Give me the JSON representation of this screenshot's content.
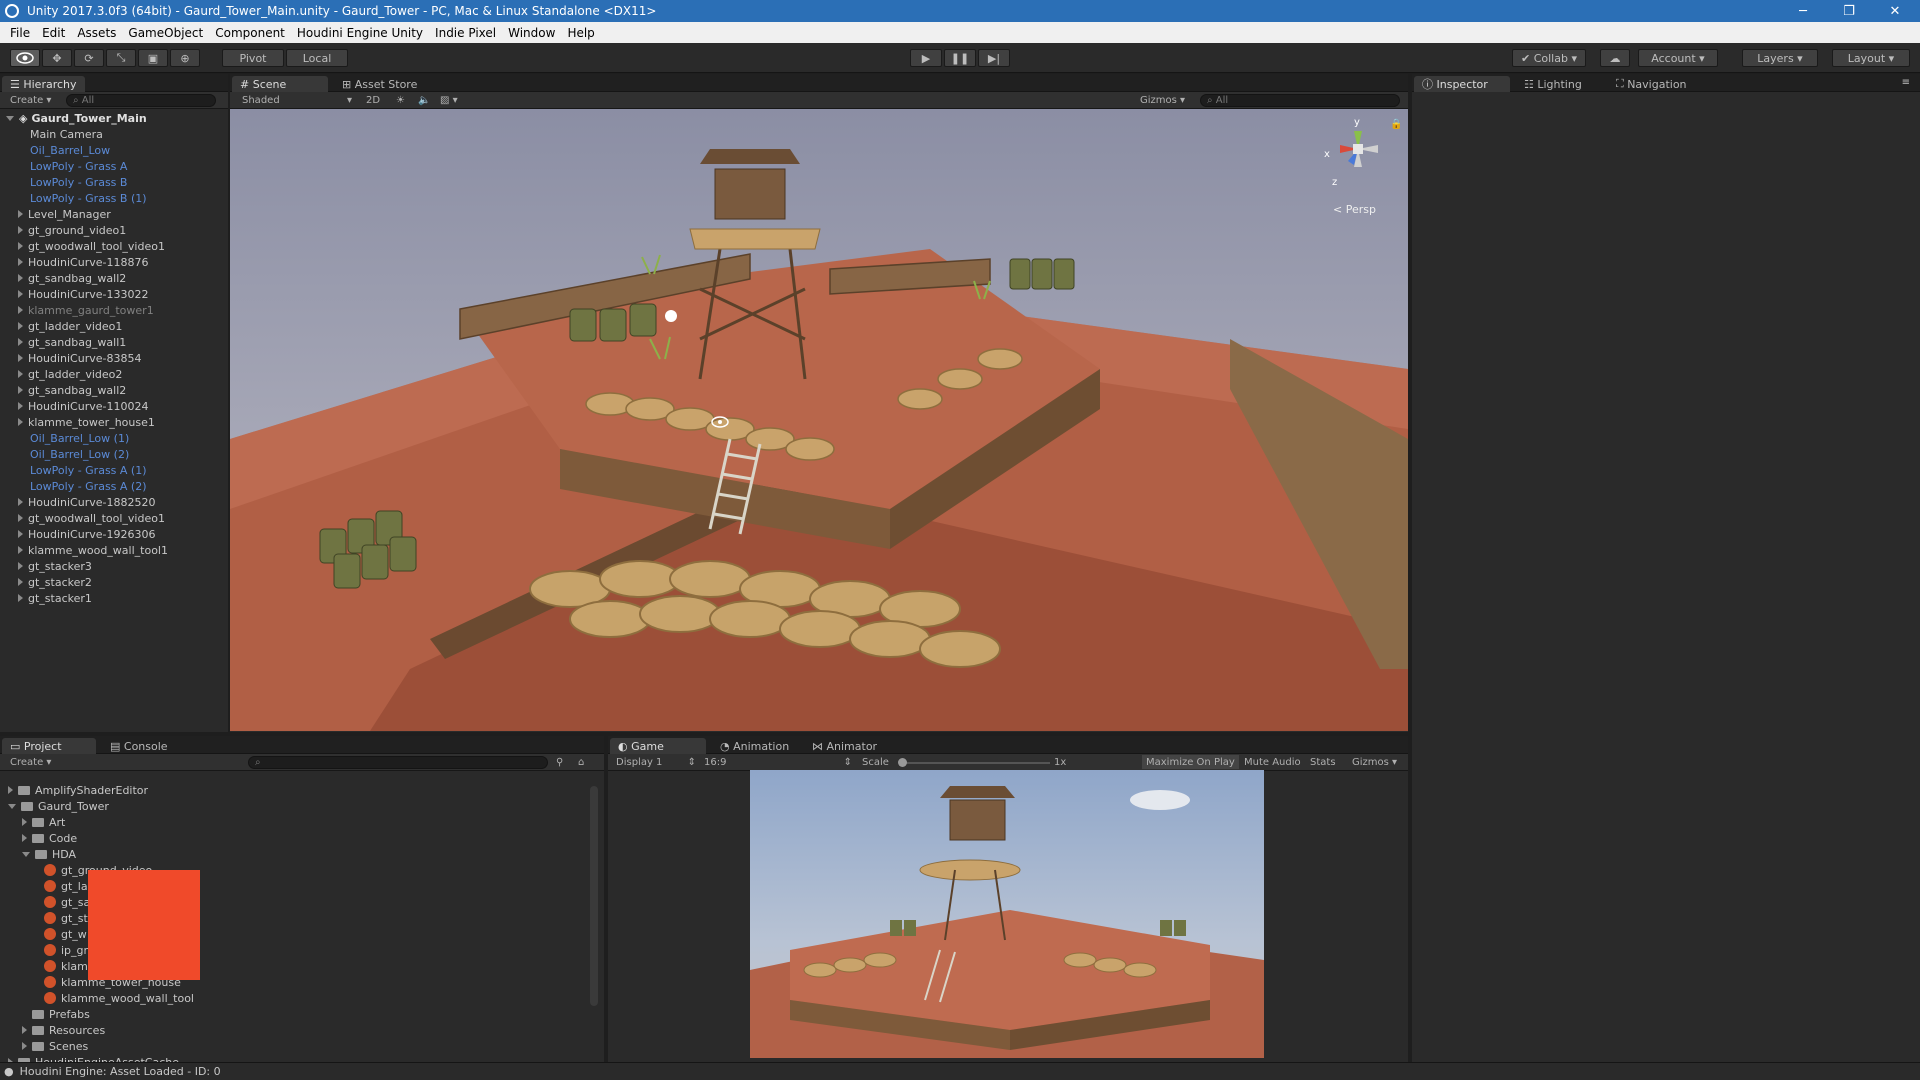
{
  "window": {
    "title": "Unity 2017.3.0f3 (64bit) - Gaurd_Tower_Main.unity - Gaurd_Tower - PC, Mac & Linux Standalone <DX11>",
    "controls": {
      "minimize": "─",
      "restore": "❐",
      "close": "✕"
    }
  },
  "menu": [
    "File",
    "Edit",
    "Assets",
    "GameObject",
    "Component",
    "Houdini Engine Unity",
    "Indie Pixel",
    "Window",
    "Help"
  ],
  "toolbar": {
    "pivot": "Pivot",
    "local": "Local",
    "collab": "Collab",
    "account": "Account",
    "layers": "Layers",
    "layout": "Layout"
  },
  "hierarchy": {
    "tab": "Hierarchy",
    "create": "Create",
    "search_placeholder": "All",
    "scene": "Gaurd_Tower_Main",
    "items": [
      {
        "label": "Main Camera",
        "kind": "normal",
        "expandable": false
      },
      {
        "label": "Oil_Barrel_Low",
        "kind": "prefab",
        "expandable": false
      },
      {
        "label": "LowPoly - Grass A",
        "kind": "prefab",
        "expandable": false
      },
      {
        "label": "LowPoly - Grass B",
        "kind": "prefab",
        "expandable": false
      },
      {
        "label": "LowPoly - Grass B (1)",
        "kind": "prefab",
        "expandable": false
      },
      {
        "label": "Level_Manager",
        "kind": "normal",
        "expandable": true
      },
      {
        "label": "gt_ground_video1",
        "kind": "normal",
        "expandable": true
      },
      {
        "label": "gt_woodwall_tool_video1",
        "kind": "normal",
        "expandable": true
      },
      {
        "label": "HoudiniCurve-118876",
        "kind": "normal",
        "expandable": true
      },
      {
        "label": "gt_sandbag_wall2",
        "kind": "normal",
        "expandable": true
      },
      {
        "label": "HoudiniCurve-133022",
        "kind": "normal",
        "expandable": true
      },
      {
        "label": "klamme_gaurd_tower1",
        "kind": "inactive",
        "expandable": true
      },
      {
        "label": "gt_ladder_video1",
        "kind": "normal",
        "expandable": true
      },
      {
        "label": "gt_sandbag_wall1",
        "kind": "normal",
        "expandable": true
      },
      {
        "label": "HoudiniCurve-83854",
        "kind": "normal",
        "expandable": true
      },
      {
        "label": "gt_ladder_video2",
        "kind": "normal",
        "expandable": true
      },
      {
        "label": "gt_sandbag_wall2",
        "kind": "normal",
        "expandable": true
      },
      {
        "label": "HoudiniCurve-110024",
        "kind": "normal",
        "expandable": true
      },
      {
        "label": "klamme_tower_house1",
        "kind": "normal",
        "expandable": true
      },
      {
        "label": "Oil_Barrel_Low (1)",
        "kind": "prefab",
        "expandable": false
      },
      {
        "label": "Oil_Barrel_Low (2)",
        "kind": "prefab",
        "expandable": false
      },
      {
        "label": "LowPoly - Grass A (1)",
        "kind": "prefab",
        "expandable": false
      },
      {
        "label": "LowPoly - Grass A (2)",
        "kind": "prefab",
        "expandable": false
      },
      {
        "label": "HoudiniCurve-1882520",
        "kind": "normal",
        "expandable": true
      },
      {
        "label": "gt_woodwall_tool_video1",
        "kind": "normal",
        "expandable": true
      },
      {
        "label": "HoudiniCurve-1926306",
        "kind": "normal",
        "expandable": true
      },
      {
        "label": "klamme_wood_wall_tool1",
        "kind": "normal",
        "expandable": true
      },
      {
        "label": "gt_stacker3",
        "kind": "normal",
        "expandable": true
      },
      {
        "label": "gt_stacker2",
        "kind": "normal",
        "expandable": true
      },
      {
        "label": "gt_stacker1",
        "kind": "normal",
        "expandable": true
      }
    ]
  },
  "scene": {
    "tabs": [
      "Scene",
      "Asset Store"
    ],
    "shading": "Shaded",
    "mode2d": "2D",
    "gizmos": "Gizmos",
    "search_placeholder": "All",
    "projection": "< Persp",
    "axes": {
      "y": "y",
      "x": "x",
      "z": "z"
    }
  },
  "inspector": {
    "tabs": [
      "Inspector",
      "Lighting",
      "Navigation"
    ]
  },
  "project": {
    "tabs": [
      "Project",
      "Console"
    ],
    "create": "Create",
    "tree": [
      {
        "label": "AmplifyShaderEditor",
        "type": "folder",
        "level": 0,
        "open": false
      },
      {
        "label": "Gaurd_Tower",
        "type": "folder",
        "level": 0,
        "open": true
      },
      {
        "label": "Art",
        "type": "folder",
        "level": 1,
        "open": false
      },
      {
        "label": "Code",
        "type": "folder",
        "level": 1,
        "open": false
      },
      {
        "label": "HDA",
        "type": "folder",
        "level": 1,
        "open": true
      },
      {
        "label": "gt_ground_video",
        "type": "hda",
        "level": 2
      },
      {
        "label": "gt_la",
        "type": "hda",
        "level": 2
      },
      {
        "label": "gt_sa",
        "type": "hda",
        "level": 2
      },
      {
        "label": "gt_st",
        "type": "hda",
        "level": 2
      },
      {
        "label": "gt_w",
        "type": "hda",
        "level": 2
      },
      {
        "label": "ip_gr",
        "type": "hda",
        "level": 2
      },
      {
        "label": "klam",
        "type": "hda",
        "level": 2
      },
      {
        "label": "klamme_tower_house",
        "type": "hda",
        "level": 2
      },
      {
        "label": "klamme_wood_wall_tool",
        "type": "hda",
        "level": 2
      },
      {
        "label": "Prefabs",
        "type": "folder",
        "level": 1,
        "open": null
      },
      {
        "label": "Resources",
        "type": "folder",
        "level": 1,
        "open": false
      },
      {
        "label": "Scenes",
        "type": "folder",
        "level": 1,
        "open": false
      },
      {
        "label": "HoudiniEngineAssetCache",
        "type": "folder",
        "level": 0,
        "open": false
      }
    ]
  },
  "game": {
    "tabs": [
      "Game",
      "Animation",
      "Animator"
    ],
    "display": "Display 1",
    "aspect": "16:9",
    "scale_label": "Scale",
    "scale_value": "1x",
    "maximize": "Maximize On Play",
    "mute": "Mute Audio",
    "stats": "Stats",
    "gizmos": "Gizmos"
  },
  "status": "Houdini Engine: Asset Loaded - ID: 0",
  "colors": {
    "accent": "#2b6fb6",
    "prefab": "#5b8ad6",
    "redaction": "#f04a2a",
    "hda": "#d1522a"
  }
}
